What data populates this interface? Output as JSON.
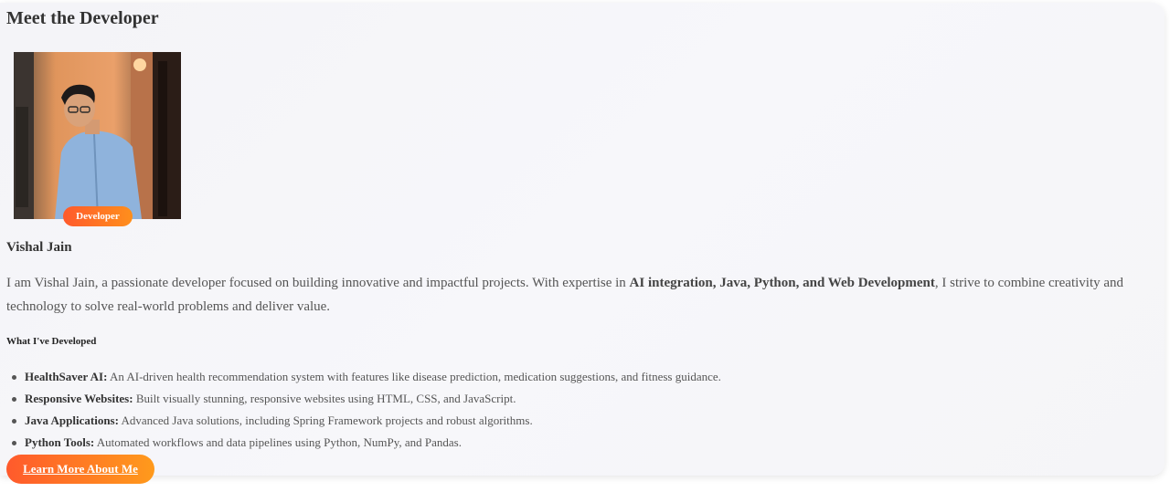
{
  "section": {
    "title": "Meet the Developer"
  },
  "developer": {
    "badge": "Developer",
    "name": "Vishal Jain",
    "bio": {
      "intro": "I am Vishal Jain, a passionate developer focused on building innovative and impactful projects. With expertise in ",
      "highlight": "AI integration, Java, Python, and Web Development",
      "outro": ", I strive to combine creativity and technology to solve real-world problems and deliver value."
    }
  },
  "projects": {
    "title": "What I've Developed",
    "items": [
      {
        "name": "HealthSaver AI:",
        "desc": " An AI-driven health recommendation system with features like disease prediction, medication suggestions, and fitness guidance."
      },
      {
        "name": "Responsive Websites:",
        "desc": " Built visually stunning, responsive websites using HTML, CSS, and JavaScript."
      },
      {
        "name": "Java Applications:",
        "desc": " Advanced Java solutions, including Spring Framework projects and robust algorithms."
      },
      {
        "name": "Python Tools:",
        "desc": " Automated workflows and data pipelines using Python, NumPy, and Pandas."
      }
    ]
  },
  "cta": {
    "label": "Learn More About Me"
  },
  "colors": {
    "accent_start": "#ff5a2c",
    "accent_end": "#ff9a1c",
    "shirt": "#8fb3dc"
  }
}
